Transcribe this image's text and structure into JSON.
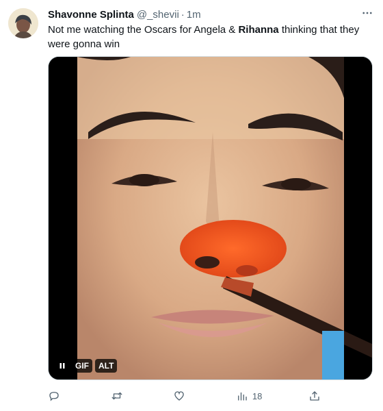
{
  "author": {
    "display_name": "Shavonne Splinta",
    "handle": "@_shevii",
    "separator": "·",
    "time": "1m"
  },
  "more_icon": "more-horizontal-icon",
  "tweet": {
    "text_before": "Not me watching the Oscars for Angela & ",
    "text_bold": "Rihanna",
    "text_after": " thinking that they were gonna win"
  },
  "media": {
    "gif_badge": "GIF",
    "alt_badge": "ALT",
    "pause_icon": "pause-icon"
  },
  "actions": {
    "reply_icon": "reply-icon",
    "retweet_icon": "retweet-icon",
    "like_icon": "heart-icon",
    "views_icon": "analytics-icon",
    "views_count": "18",
    "share_icon": "share-icon"
  },
  "colors": {
    "text": "#0f1419",
    "secondary": "#536471",
    "border": "#cfd9de"
  }
}
